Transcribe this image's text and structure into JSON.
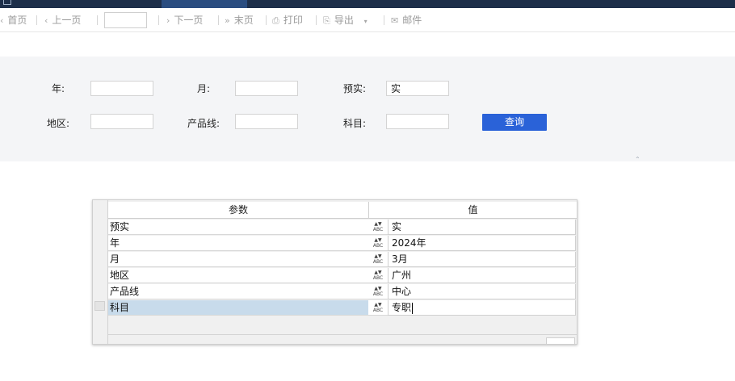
{
  "toolbar": {
    "first_page": "首页",
    "prev_page": "上一页",
    "page_input_value": "",
    "next_page": "下一页",
    "last_page": "末页",
    "print": "打印",
    "export": "导出",
    "mail": "邮件"
  },
  "query": {
    "year_label": "年:",
    "month_label": "月:",
    "budget_actual_label": "预实:",
    "budget_actual_value": "实",
    "region_label": "地区:",
    "product_line_label": "产品线:",
    "subject_label": "科目:",
    "search_button": "查询"
  },
  "param_grid": {
    "header_param": "参数",
    "header_value": "值",
    "type_icon_text": "ABC",
    "rows": [
      {
        "param": "预实",
        "value": "实"
      },
      {
        "param": "年",
        "value": "2024年"
      },
      {
        "param": "月",
        "value": "3月"
      },
      {
        "param": "地区",
        "value": "广州"
      },
      {
        "param": "产品线",
        "value": "中心"
      },
      {
        "param": "科目",
        "value": "专职"
      }
    ],
    "selected_row": 5
  },
  "colors": {
    "accent": "#2a62d8",
    "topbar": "#1d2f4a",
    "selected_row": "#c8dbeb"
  }
}
